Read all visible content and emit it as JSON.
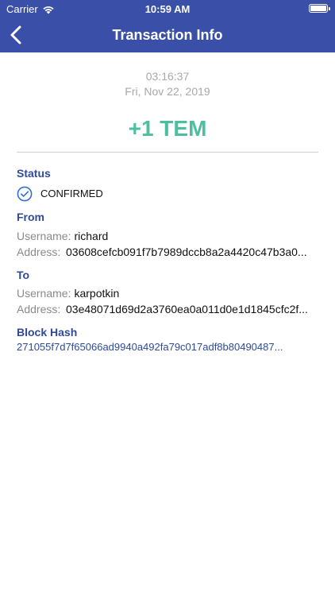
{
  "status_bar": {
    "carrier": "Carrier",
    "time": "10:59 AM"
  },
  "header": {
    "title": "Transaction Info",
    "back_icon": "chevron-left-icon"
  },
  "transaction": {
    "time": "03:16:37",
    "date": "Fri, Nov 22, 2019",
    "amount": "+1 TEM"
  },
  "status": {
    "label": "Status",
    "value": "CONFIRMED",
    "icon": "check-circle-icon"
  },
  "from": {
    "label": "From",
    "username_label": "Username:",
    "username": "richard",
    "address_label": "Address:",
    "address": "03608cefcb091f7b7989dccb8a2a4420c47b3a0..."
  },
  "to": {
    "label": "To",
    "username_label": "Username:",
    "username": "karpotkin",
    "address_label": "Address:",
    "address": "03e48071d69d2a3760ea0a011d0e1d1845cfc2f..."
  },
  "block_hash": {
    "label": "Block Hash",
    "value": "271055f7d7f65066ad9940a492fa79c017adf8b80490487..."
  },
  "colors": {
    "header": "#3a50a8",
    "accent": "#2f4a9a",
    "amount": "#4cbfa0"
  }
}
